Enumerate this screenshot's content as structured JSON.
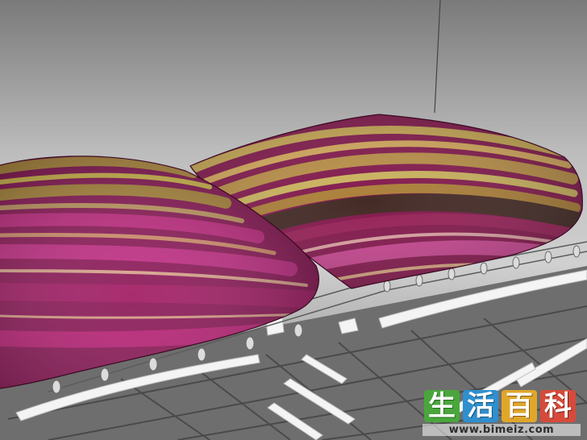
{
  "watermark": {
    "characters": [
      "生",
      "活",
      "百",
      "科"
    ],
    "url": "www.bimeiz.com"
  },
  "scene": {
    "background_color": "#8d8d8d",
    "rack_color": "#f2f2f2",
    "pillow_left_colors": [
      "#c1277f",
      "#8b1656",
      "#c7a64c",
      "#d18d6a"
    ],
    "pillow_right_colors": [
      "#7d0d44",
      "#3a1f1a",
      "#b78a3e",
      "#c33c8a"
    ]
  }
}
